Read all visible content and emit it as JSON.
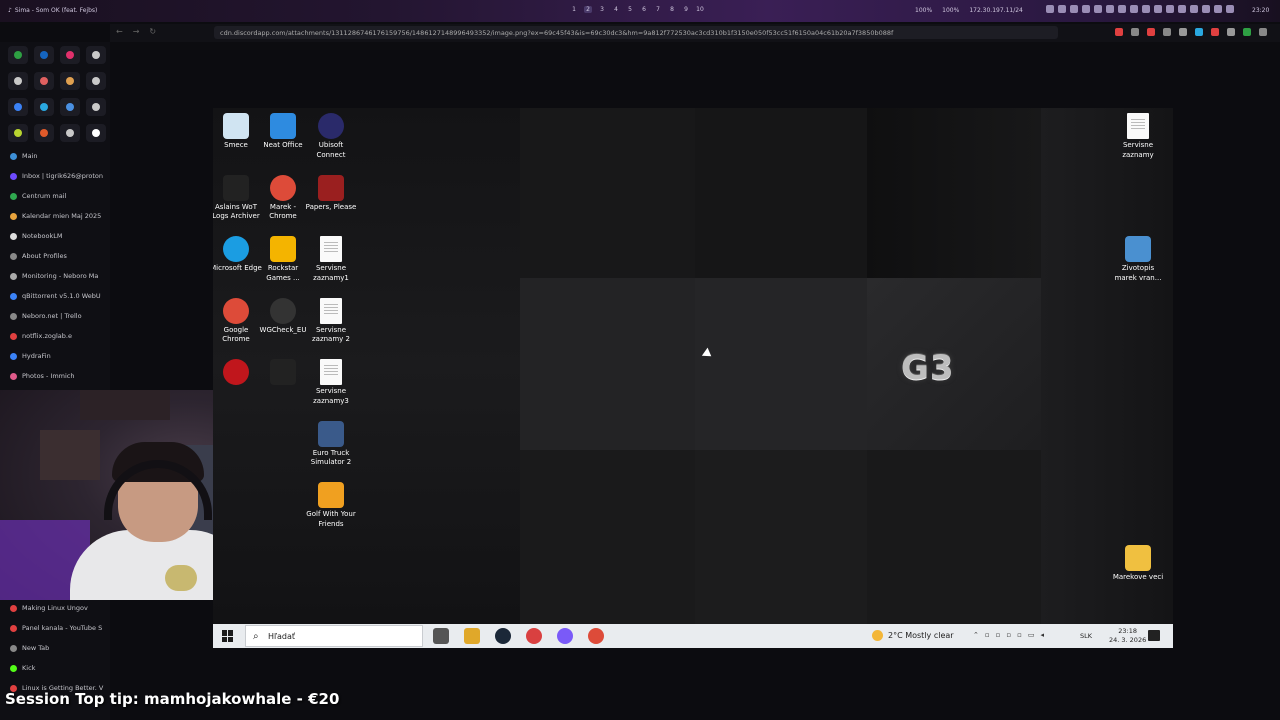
{
  "topbar": {
    "now_playing": "Sima - Som OK (feat. Fejbs)",
    "workspaces": [
      "1",
      "2",
      "3",
      "4",
      "5",
      "6",
      "7",
      "8",
      "9",
      "10"
    ],
    "active_workspace": 1,
    "status_cpu": "100%",
    "status_mem": "100%",
    "ip_address": "172.30.197.11/24",
    "clock": "23:20"
  },
  "browser": {
    "url_host": "cdn.discordapp.com",
    "url_path": "/attachments/1311286746176159756/1486127148996493352/image.png?ex=69c45f43&is=69c30dc3&hm=9a812f772530ac3cd310b1f3150e050f53cc51f6150a04c61b20a7f3850b088f"
  },
  "sidebar": {
    "shortcut_colors": [
      "#2ea043",
      "#1565c0",
      "#e1306c",
      "#c9c9c9",
      "#c9c9c9",
      "#e06060",
      "#e0a050",
      "#c9c9c9",
      "#3b82f6",
      "#2aa8e0",
      "#4a90e2",
      "#c9c9c9",
      "#b8d430",
      "#e05a2a",
      "#c9c9c9",
      "#ffffff"
    ],
    "tabs": [
      {
        "label": "Main",
        "color": "#3d8fd6"
      },
      {
        "label": "Inbox | tigrik626@proton",
        "color": "#6d4aff"
      },
      {
        "label": "Centrum mail",
        "color": "#2fa84f"
      },
      {
        "label": "Kalendar mien Maj 2025",
        "color": "#e8a33d"
      },
      {
        "label": "NotebookLM",
        "color": "#dddddd"
      },
      {
        "label": "About Profiles",
        "color": "#888888"
      },
      {
        "label": "Monitoring - Neboro Ma",
        "color": "#aaaaaa"
      },
      {
        "label": "qBittorrent v5.1.0 WebU",
        "color": "#3b82f6"
      },
      {
        "label": "Neboro.net | Trello",
        "color": "#888888"
      },
      {
        "label": "notflix.zoglab.e",
        "color": "#e04040"
      },
      {
        "label": "HydraFin",
        "color": "#3b82f6"
      },
      {
        "label": "Photos - Immich",
        "color": "#e05a8a"
      }
    ],
    "bottom_tabs": [
      {
        "label": "Making Linux Ungov",
        "color": "#e04040"
      },
      {
        "label": "Panel kanala - YouTube S",
        "color": "#e04040"
      },
      {
        "label": "New Tab",
        "color": "#888888"
      },
      {
        "label": "Kick",
        "color": "#53fc18"
      },
      {
        "label": "Linux is Getting Better. V",
        "color": "#e04040"
      }
    ]
  },
  "desktop": {
    "icons_left": [
      {
        "label": "Smece",
        "icon": "recycle-bin-icon",
        "color": "#d0e4f2"
      },
      {
        "label": "Neat Office",
        "icon": "neat-office-icon",
        "color": "#2e8be0"
      },
      {
        "label": "Ubisoft Connect",
        "icon": "ubisoft-icon",
        "color": "#2a2a6a"
      },
      {
        "label": "Aslains WoT Logs Archiver",
        "icon": "aslain-icon",
        "color": "#222222"
      },
      {
        "label": "Marek - Chrome",
        "icon": "chrome-icon",
        "color": "#dd4b39"
      },
      {
        "label": "Papers, Please",
        "icon": "papers-please-icon",
        "color": "#9a1f1f"
      },
      {
        "label": "Microsoft Edge",
        "icon": "edge-icon",
        "color": "#1b9de2"
      },
      {
        "label": "Rockstar Games ...",
        "icon": "rockstar-icon",
        "color": "#f4b400"
      },
      {
        "label": "Servisne zaznamy1",
        "icon": "document-icon",
        "color": "#fafafa"
      },
      {
        "label": "Google Chrome",
        "icon": "chrome-icon",
        "color": "#dd4b39"
      },
      {
        "label": "WGCheck_EU",
        "icon": "wgcheck-icon",
        "color": "#333333"
      },
      {
        "label": "Servisne zaznamy 2",
        "icon": "document-icon",
        "color": "#fafafa"
      },
      {
        "label": "",
        "icon": "wot-icon",
        "color": "#c0161c"
      },
      {
        "label": "",
        "icon": "aslain-icon",
        "color": "#222222"
      },
      {
        "label": "Servisne zaznamy3",
        "icon": "document-icon",
        "color": "#fafafa"
      },
      {
        "label": "Euro Truck Simulator 2",
        "icon": "ets2-icon",
        "color": "#3a5a8a"
      },
      {
        "label": "Golf With Your Friends",
        "icon": "golf-icon",
        "color": "#f0a020"
      }
    ],
    "icons_right": [
      {
        "label": "Servisne zaznamy",
        "icon": "document-icon",
        "color": "#fafafa"
      },
      {
        "label": "Zivotopis marek vran...",
        "icon": "cv-icon",
        "color": "#4a90d0"
      },
      {
        "label": "Marekove veci",
        "icon": "folder-icon",
        "color": "#f0c040"
      }
    ],
    "logo_text": "G3"
  },
  "taskbar": {
    "search_placeholder": "Hľadať",
    "weather": "2°C  Mostly clear",
    "language": "SLK",
    "time": "23:18",
    "date": "24. 3. 2026",
    "app_colors": [
      "#555555",
      "#e0a82a",
      "#1b2838",
      "#d94040",
      "#7a5af8",
      "#dd4b39"
    ]
  },
  "overlay": {
    "tip_text": "Session Top tip: mamhojakowhale - €20"
  }
}
